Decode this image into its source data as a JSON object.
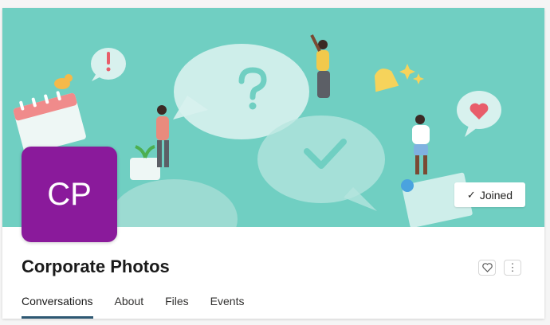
{
  "group": {
    "initials": "CP",
    "name": "Corporate Photos",
    "avatar_color": "#8a1a9b",
    "banner_color": "#70cfc2"
  },
  "banner": {
    "illustration": "group-header-illustration"
  },
  "actions": {
    "joined_label": "Joined",
    "joined_icon": "check-icon",
    "favorite_icon": "heart-outline-icon",
    "more_icon": "more-vertical-icon"
  },
  "tabs": [
    {
      "label": "Conversations",
      "active": true
    },
    {
      "label": "About",
      "active": false
    },
    {
      "label": "Files",
      "active": false
    },
    {
      "label": "Events",
      "active": false
    }
  ],
  "colors": {
    "tab_underline": "#2e5873"
  }
}
